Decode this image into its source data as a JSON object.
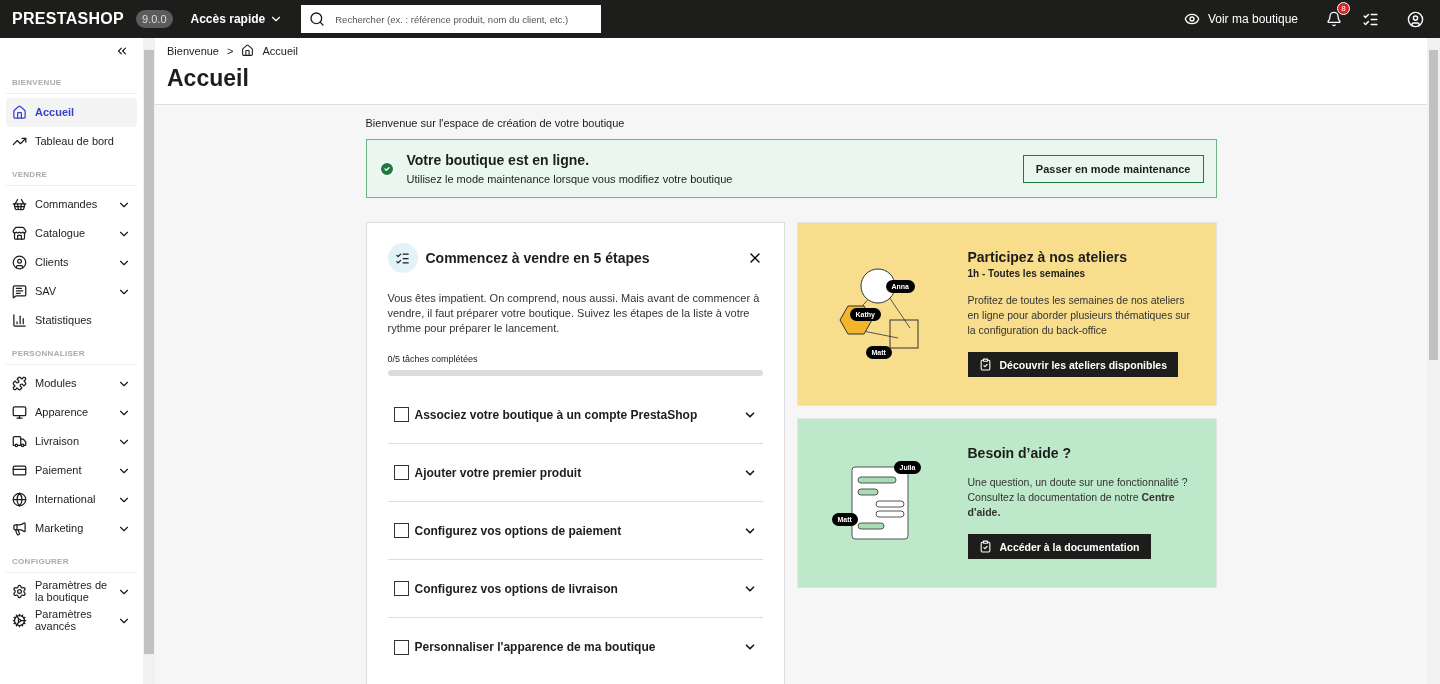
{
  "topbar": {
    "logo": "PRESTASHOP",
    "version": "9.0.0",
    "quick_access": "Accès rapide",
    "search": {
      "placeholder": "Rechercher (ex. : référence produit, nom du client, etc.)"
    },
    "view_shop": "Voir ma boutique",
    "notifications": "8"
  },
  "sidebar": {
    "sections": [
      {
        "title": "BIENVENUE",
        "items": [
          {
            "label": "Accueil",
            "selected": true,
            "has_submenu": false
          },
          {
            "label": "Tableau de bord",
            "selected": false,
            "has_submenu": false
          }
        ]
      },
      {
        "title": "VENDRE",
        "items": [
          {
            "label": "Commandes",
            "selected": false,
            "has_submenu": true
          },
          {
            "label": "Catalogue",
            "selected": false,
            "has_submenu": true
          },
          {
            "label": "Clients",
            "selected": false,
            "has_submenu": true
          },
          {
            "label": "SAV",
            "selected": false,
            "has_submenu": true
          },
          {
            "label": "Statistiques",
            "selected": false,
            "has_submenu": false
          }
        ]
      },
      {
        "title": "PERSONNALISER",
        "items": [
          {
            "label": "Modules",
            "selected": false,
            "has_submenu": true
          },
          {
            "label": "Apparence",
            "selected": false,
            "has_submenu": true
          },
          {
            "label": "Livraison",
            "selected": false,
            "has_submenu": true
          },
          {
            "label": "Paiement",
            "selected": false,
            "has_submenu": true
          },
          {
            "label": "International",
            "selected": false,
            "has_submenu": true
          },
          {
            "label": "Marketing",
            "selected": false,
            "has_submenu": true
          }
        ]
      },
      {
        "title": "CONFIGURER",
        "items": [
          {
            "label": "Paramètres de la boutique",
            "selected": false,
            "has_submenu": true
          },
          {
            "label": "Paramètres avancés",
            "selected": false,
            "has_submenu": true
          }
        ]
      }
    ]
  },
  "header": {
    "breadcrumb": [
      "Bienvenue",
      "Accueil"
    ],
    "separator": ">",
    "title": "Accueil"
  },
  "welcome": "Bienvenue sur l'espace de création de votre boutique",
  "status": {
    "title": "Votre boutique est en ligne.",
    "text": "Utilisez le mode maintenance lorsque vous modifiez votre boutique",
    "button": "Passer en mode maintenance"
  },
  "checklist": {
    "title": "Commencez à vendre en 5 étapes",
    "intro": "Vous êtes impatient. On comprend, nous aussi. Mais avant de commencer à vendre, il faut préparer votre boutique. Suivez les étapes de la liste à votre rythme pour préparer le lancement.",
    "progress_label": "0/5 tâches complétées",
    "level": 0,
    "steps": [
      {
        "label": "Associez votre boutique à un compte PrestaShop",
        "checked": false
      },
      {
        "label": "Ajouter votre premier produit",
        "checked": false
      },
      {
        "label": "Configurez vos options de paiement",
        "checked": false
      },
      {
        "label": "Configurez vos options de livraison",
        "checked": false
      },
      {
        "label": "Personnaliser l'apparence de ma boutique",
        "checked": false
      }
    ]
  },
  "workshop": {
    "title": "Participez à nos ateliers",
    "subtitle": "1h - Toutes les semaines",
    "text": "Profitez de toutes les semaines de nos ateliers en ligne pour aborder plusieurs thématiques sur la configuration du back-office",
    "button": "Découvrir les ateliers disponibles",
    "tags": [
      "Anna",
      "Kathy",
      "Matt"
    ]
  },
  "help": {
    "title": "Besoin d’aide ?",
    "text": "Une question, un doute sur une fonctionnalité ? Consultez la documentation de notre **Centre d'aide.**",
    "button": "Accéder à la documentation",
    "tags": [
      "Julia",
      "Matt"
    ]
  }
}
